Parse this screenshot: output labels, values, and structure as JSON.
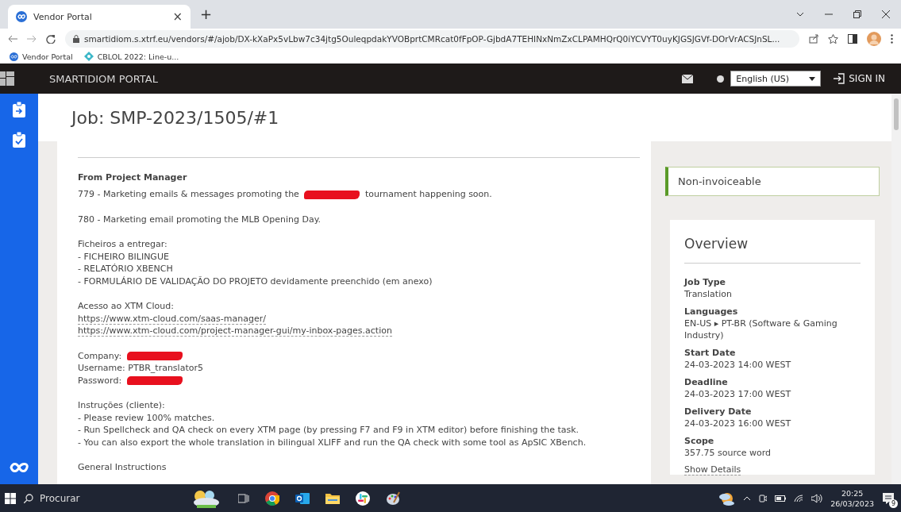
{
  "browser": {
    "tabs": [
      {
        "title": "Vendor Portal",
        "close": "×",
        "selected": true
      }
    ],
    "new_tab": "+",
    "url": "smartidiom.s.xtrf.eu/vendors/#/ajob/DX-kXaPx5vLbw7c34jtg5OuleqpdakYVOBprtCMRcat0fFpOP-GjbdA7TEHINxNmZxCLPAMHQrQ0iYCVYT0uyKJGSJGVf-DOrVrACSJnSL...",
    "bookmarks": [
      "Vendor Portal",
      "CBLOL 2022: Line-u..."
    ]
  },
  "header": {
    "title": "SMARTIDIOM PORTAL",
    "language": "English (US)",
    "sign_in": "SIGN IN"
  },
  "job": {
    "title": "Job: SMP-2023/1505/#1"
  },
  "notes": {
    "heading": "From Project Manager",
    "blocks": [
      [
        {
          "kind": "redacted",
          "before": "779 - Marketing emails & messages promoting the",
          "after": "tournament happening soon."
        }
      ],
      [
        {
          "kind": "text",
          "text": "780 - Marketing email promoting the MLB Opening Day."
        }
      ],
      [
        {
          "kind": "text",
          "text": "Ficheiros a entregar:"
        },
        {
          "kind": "text",
          "text": "- FICHEIRO BILINGUE"
        },
        {
          "kind": "text",
          "text": "- RELATÓRIO XBENCH"
        },
        {
          "kind": "text",
          "text": "- FORMULÁRIO DE VALIDAÇÃO DO PROJETO devidamente preenchido (em anexo)"
        }
      ],
      [
        {
          "kind": "text",
          "text": "Acesso ao XTM Cloud:"
        },
        {
          "kind": "link",
          "text": "https://www.xtm-cloud.com/saas-manager/"
        },
        {
          "kind": "link",
          "text": "https://www.xtm-cloud.com/project-manager-gui/my-inbox-pages.action"
        }
      ],
      [
        {
          "kind": "redacted",
          "before": "Company:"
        },
        {
          "kind": "text",
          "text": "Username: PTBR_translator5"
        },
        {
          "kind": "redacted",
          "before": "Password:"
        }
      ],
      [
        {
          "kind": "text",
          "text": "Instruções (cliente):"
        },
        {
          "kind": "text",
          "text": "- Please review 100% matches."
        },
        {
          "kind": "text",
          "text": "- Run Spellcheck and QA check on every XTM page (by pressing F7 and F9 in XTM editor) before finishing the task."
        },
        {
          "kind": "text",
          "text": "- You can also export the whole translation in bilingual XLIFF and run the QA check with some tool as ApSIC XBench."
        }
      ],
      [
        {
          "kind": "text",
          "text": "General Instructions"
        }
      ]
    ]
  },
  "status": "Non-invoiceable",
  "overview": {
    "title": "Overview",
    "fields": [
      {
        "label": "Job Type",
        "value": "Translation"
      },
      {
        "label": "Languages",
        "value": "EN-US ▸ PT-BR (Software & Gaming Industry)"
      },
      {
        "label": "Start Date",
        "value": "24-03-2023 14:00 WEST"
      },
      {
        "label": "Deadline",
        "value": "24-03-2023 17:00 WEST"
      },
      {
        "label": "Delivery Date",
        "value": "24-03-2023 16:00 WEST"
      },
      {
        "label": "Scope",
        "value": "357.75 source word"
      }
    ],
    "details_link": "Show Details"
  },
  "taskbar": {
    "search_placeholder": "Procurar",
    "time": "20:25",
    "date": "26/03/2023",
    "notifications": "9"
  }
}
